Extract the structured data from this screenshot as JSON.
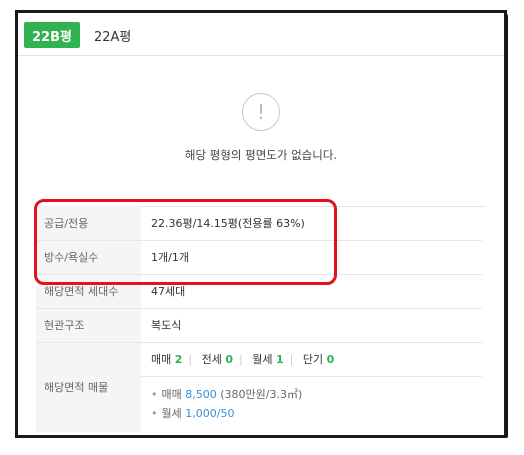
{
  "tabs": [
    {
      "label": "22B평",
      "active": true
    },
    {
      "label": "22A평",
      "active": false
    }
  ],
  "empty_state": {
    "icon": "exclamation-icon",
    "message": "해당 평형의 평면도가 없습니다."
  },
  "info": {
    "supply": {
      "label": "공급/전용",
      "value": "22.36평/14.15평(전용률 63%)"
    },
    "rooms": {
      "label": "방수/욕실수",
      "value": "1개/1개"
    },
    "households": {
      "label": "해당면적 세대수",
      "value": "47세대"
    },
    "entrance": {
      "label": "현관구조",
      "value": "복도식"
    },
    "listings": {
      "label": "해당면적 매물",
      "counts": [
        {
          "type": "매매",
          "count": "2"
        },
        {
          "type": "전세",
          "count": "0"
        },
        {
          "type": "월세",
          "count": "1"
        },
        {
          "type": "단기",
          "count": "0"
        }
      ],
      "sale": {
        "type": "매매",
        "price": "8,500",
        "detail": "(380만원/3.3㎡)"
      },
      "rent": {
        "type": "월세",
        "price": "1,000/50"
      }
    }
  },
  "colors": {
    "accent": "#2fb24f",
    "highlight": "#e0151a",
    "price": "#3b8fd6"
  }
}
